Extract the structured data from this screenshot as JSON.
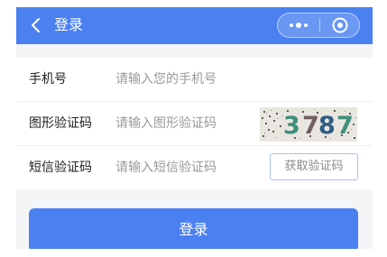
{
  "navbar": {
    "title": "登录",
    "back_icon": "chevron-left-icon",
    "more_icon": "more-dots-icon",
    "close_icon": "target-circle-icon",
    "color": "#4a80f0"
  },
  "form": {
    "phone": {
      "label": "手机号",
      "placeholder": "请输入您的手机号",
      "value": ""
    },
    "image_captcha": {
      "label": "图形验证码",
      "placeholder": "请输入图形验证码",
      "value": "",
      "captcha_text": "3787"
    },
    "sms_code": {
      "label": "短信验证码",
      "placeholder": "请输入短信验证码",
      "value": "",
      "button_label": "获取验证码"
    }
  },
  "submit": {
    "label": "登录"
  }
}
